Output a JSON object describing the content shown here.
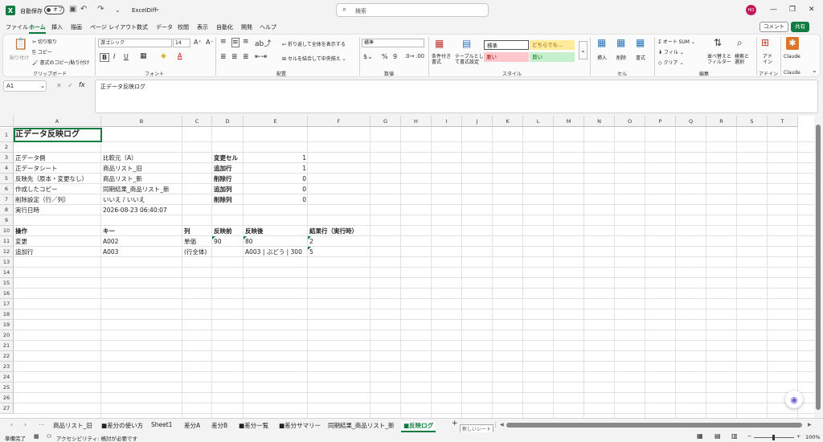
{
  "titlebar": {
    "autosave_label": "自動保存",
    "autosave_state": "オフ",
    "filename": "ExcelDiff",
    "search_placeholder": "検索",
    "avatar_initials": "HO"
  },
  "menu": {
    "items": [
      "ファイル",
      "ホーム",
      "挿入",
      "描画",
      "ページ レイアウト",
      "数式",
      "データ",
      "校閲",
      "表示",
      "自動化",
      "開発",
      "ヘルプ"
    ],
    "active": "ホーム",
    "comment_button": "コメント",
    "share_button": "共有"
  },
  "ribbon": {
    "clipboard": {
      "paste": "貼り付け",
      "cut": "切り取り",
      "copy": "コピー",
      "format_painter": "書式のコピー/貼り付け",
      "label": "クリップボード"
    },
    "font": {
      "name": "游ゴシック",
      "size": "14",
      "label": "フォント"
    },
    "alignment": {
      "wrap": "折り返して全体を表示する",
      "merge": "セルを結合して中央揃え",
      "label": "配置"
    },
    "number": {
      "format": "標準",
      "label": "数値"
    },
    "styles": {
      "conditional": "条件付き書式",
      "table": "テーブルとして書式設定",
      "cells": [
        "標準",
        "どちらでも...",
        "悪い",
        "良い"
      ],
      "label": "スタイル"
    },
    "cells": {
      "insert": "挿入",
      "delete": "削除",
      "format": "書式",
      "label": "セル"
    },
    "editing": {
      "autosum": "オート SUM",
      "fill": "フィル",
      "clear": "クリア",
      "sort": "並べ替えとフィルター",
      "find": "検索と選択",
      "label": "編集"
    },
    "addins": {
      "addin": "アドイン",
      "label": "アドイン"
    },
    "claude": {
      "name": "Claude",
      "label": "Claude"
    }
  },
  "formula": {
    "namebox": "A1",
    "fx": "fx",
    "content": "正データ反映ログ"
  },
  "columns": [
    "A",
    "B",
    "C",
    "D",
    "E",
    "F",
    "G",
    "H",
    "I",
    "J",
    "K",
    "L",
    "M",
    "N",
    "O",
    "P",
    "Q",
    "R",
    "S",
    "T"
  ],
  "rows": [
    "1",
    "2",
    "3",
    "4",
    "5",
    "6",
    "7",
    "8",
    "9",
    "10",
    "11",
    "12",
    "13",
    "14",
    "15",
    "16",
    "17",
    "18",
    "19",
    "20",
    "21",
    "22",
    "23",
    "24",
    "25",
    "26",
    "27"
  ],
  "sheet": {
    "A1": "正データ反映ログ",
    "A3": "正データ側",
    "B3": "比較元（A）",
    "A4": "正データシート",
    "B4": "商品リスト_旧",
    "A5": "反映先（原本・変更なし）",
    "B5": "商品リスト_新",
    "A6": "作成したコピー",
    "B6": "同期結果_商品リスト_新",
    "A7": "削除設定（行／列）",
    "B7": "いいえ / いいえ",
    "A8": "実行日時",
    "B8": "2026-08-23 06:40:07",
    "D3": "変更セル",
    "E3": "1",
    "D4": "追加行",
    "E4": "1",
    "D5": "削除行",
    "E5": "0",
    "D6": "追加列",
    "E6": "0",
    "D7": "削除列",
    "E7": "0",
    "A10": "操作",
    "B10": "キー",
    "C10": "列",
    "D10": "反映前",
    "E10": "反映後",
    "F10": "結果行（実行時）",
    "A11": "変更",
    "B11": "A002",
    "C11": "単価",
    "D11": "90",
    "E11": "80",
    "F11": "2",
    "A12": "追加行",
    "B12": "A003",
    "C12": "(行全体)",
    "D12": "",
    "E12": "A003 | ぶどう | 300",
    "F12": "5"
  },
  "tabs": [
    "商品リスト_旧",
    "■差分の使い方",
    "Sheet1",
    "差分A",
    "差分B",
    "■差分一覧",
    "■差分サマリー",
    "同期結果_商品リスト_新",
    "■反映ログ"
  ],
  "active_tab": "■反映ログ",
  "new_sheet_tooltip": "新しいシート",
  "status": {
    "ready": "準備完了",
    "accessibility": "アクセシビリティ: 検討が必要です",
    "zoom": "100%"
  }
}
